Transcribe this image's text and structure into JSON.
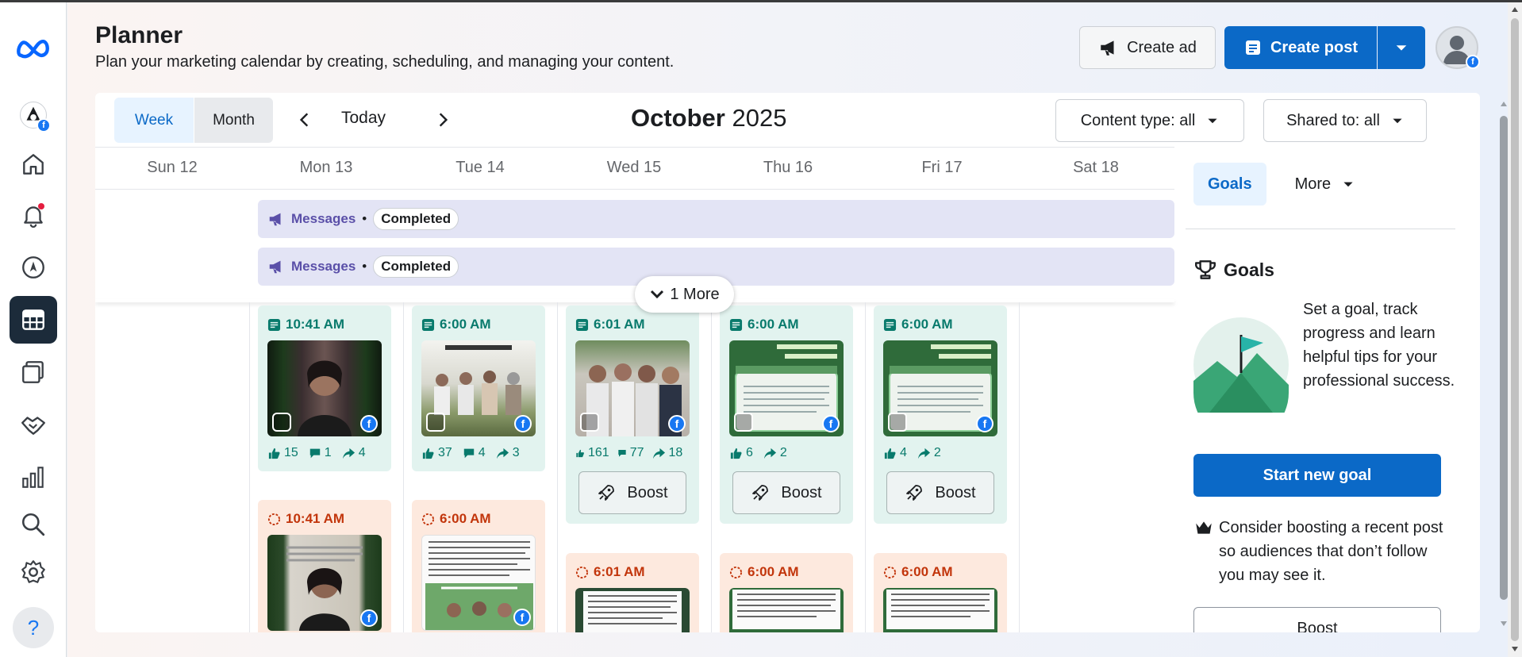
{
  "header": {
    "title": "Planner",
    "subtitle": "Plan your marketing calendar by creating, scheduling, and managing your content.",
    "create_ad": "Create ad",
    "create_post": "Create post"
  },
  "toolbar": {
    "week": "Week",
    "month": "Month",
    "today": "Today",
    "month_name": "October",
    "year": "2025",
    "content_type": "Content type: all",
    "shared_to": "Shared to: all"
  },
  "days": [
    "Sun 12",
    "Mon 13",
    "Tue 14",
    "Wed 15",
    "Thu 16",
    "Fri 17",
    "Sat 18"
  ],
  "banners": [
    {
      "label": "Messages",
      "sep": "•",
      "status": "Completed"
    },
    {
      "label": "Messages",
      "sep": "•",
      "status": "Completed"
    }
  ],
  "more_label": "1 More",
  "published_cards": [
    {
      "time": "10:41 AM",
      "likes": "15",
      "comments": "1",
      "shares": "4",
      "boost": ""
    },
    {
      "time": "6:00 AM",
      "likes": "37",
      "comments": "4",
      "shares": "3",
      "boost": ""
    },
    {
      "time": "6:01 AM",
      "likes": "161",
      "comments": "77",
      "shares": "18",
      "boost": "Boost"
    },
    {
      "time": "6:00 AM",
      "likes": "6",
      "comments": "",
      "shares": "2",
      "boost": "Boost"
    },
    {
      "time": "6:00 AM",
      "likes": "4",
      "comments": "",
      "shares": "2",
      "boost": "Boost"
    }
  ],
  "scheduled_cards": [
    {
      "time": "10:41 AM"
    },
    {
      "time": "6:00 AM"
    },
    {
      "time": "6:01 AM"
    },
    {
      "time": "6:00 AM"
    },
    {
      "time": "6:00 AM"
    }
  ],
  "right_panel": {
    "tab_goals": "Goals",
    "tab_more": "More",
    "goals_title": "Goals",
    "goals_text": "Set a goal, track progress and learn helpful tips for your professional success.",
    "start_goal": "Start new goal",
    "tip": "Consider boosting a recent post so audiences that don’t follow you may see it.",
    "boost": "Boost"
  },
  "colors": {
    "accent": "#0b69c7",
    "published_bg": "#e2f3ef",
    "scheduled_bg": "#fde9de",
    "banner_bg": "#e3e4f5"
  },
  "icons": [
    "meta-logo",
    "profile-icon",
    "home-icon",
    "bell-icon",
    "compass-icon",
    "calendar-grid-icon",
    "content-icon",
    "handshake-icon",
    "bar-chart-icon",
    "search-icon",
    "gear-icon",
    "help-icon"
  ]
}
